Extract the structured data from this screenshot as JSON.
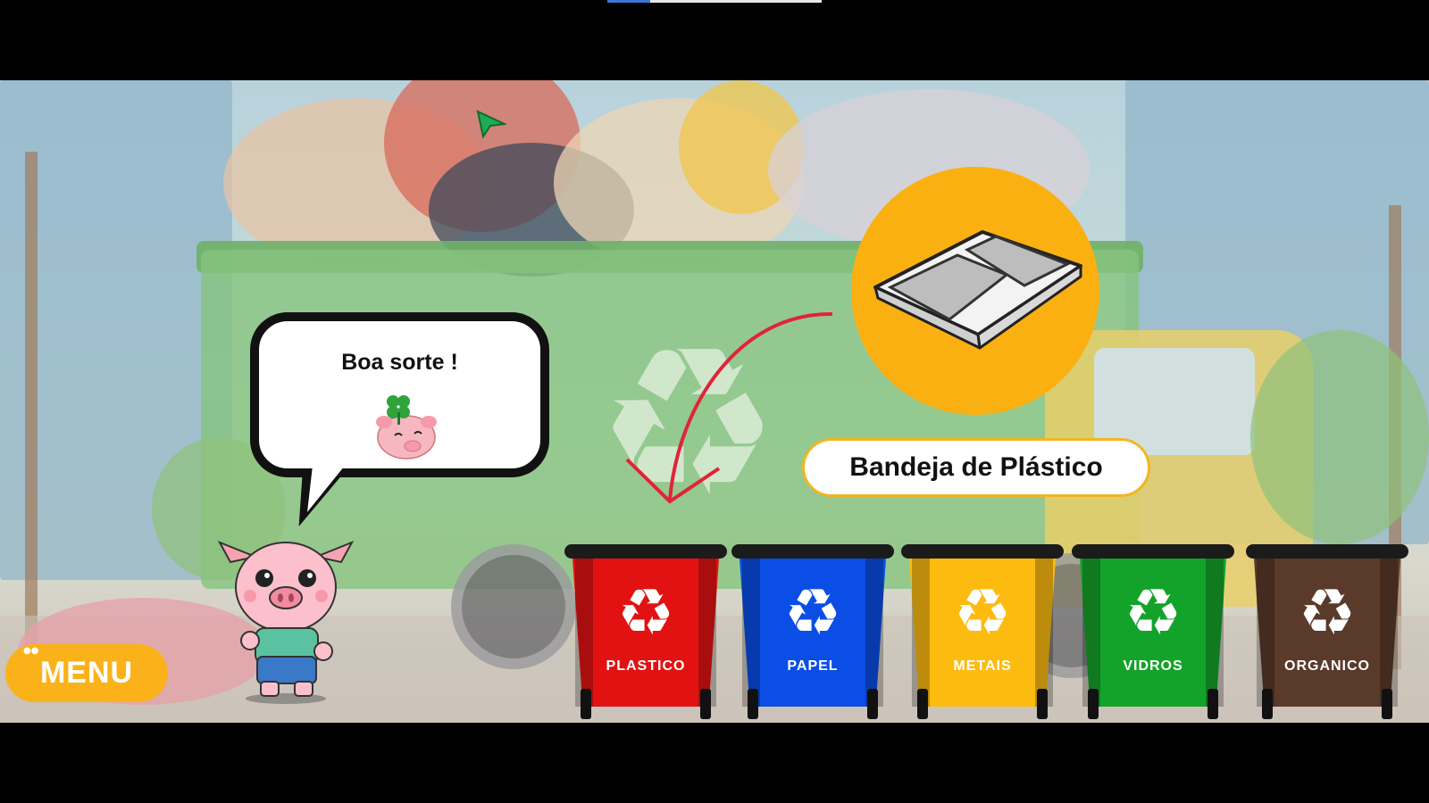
{
  "progress": {
    "value": 0.2,
    "fill_color": "#3a78d8"
  },
  "speech": {
    "text": "Boa sorte !"
  },
  "item": {
    "name": "Bandeja de Plástico",
    "icon": "plastic-tray-icon",
    "circle_color": "#fbb012",
    "target_bin": "PLASTICO"
  },
  "menu": {
    "label": "MENU",
    "color": "#fbb21a"
  },
  "bins": [
    {
      "label": "PLASTICO",
      "color": "#e21212",
      "icon": "recycle-icon"
    },
    {
      "label": "PAPEL",
      "color": "#0a4ee6",
      "icon": "recycle-icon"
    },
    {
      "label": "METAIS",
      "color": "#fdbb10",
      "icon": "recycle-icon"
    },
    {
      "label": "VIDROS",
      "color": "#14a32a",
      "icon": "recycle-icon"
    },
    {
      "label": "ORGANICO",
      "color": "#5a3a2a",
      "icon": "recycle-icon"
    }
  ]
}
